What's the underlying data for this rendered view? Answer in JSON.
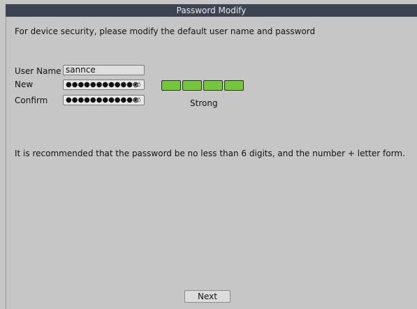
{
  "window": {
    "title": "Password Modify"
  },
  "intro_text": "For device security, please modify the default user name and password",
  "form": {
    "username": {
      "label": "User Name",
      "value": "sannce"
    },
    "new_password": {
      "label": "New",
      "value": "●●●●●●●●●●●●",
      "icon": "eye-icon"
    },
    "confirm_password": {
      "label": "Confirm",
      "value": "●●●●●●●●●●●●",
      "icon": "eye-icon"
    }
  },
  "strength": {
    "label": "Strong",
    "level": 4,
    "max": 4,
    "color": "#74c63c"
  },
  "recommendation": "It is recommended that the password be no less than 6 digits, and the number + letter form.",
  "buttons": {
    "next": "Next"
  }
}
